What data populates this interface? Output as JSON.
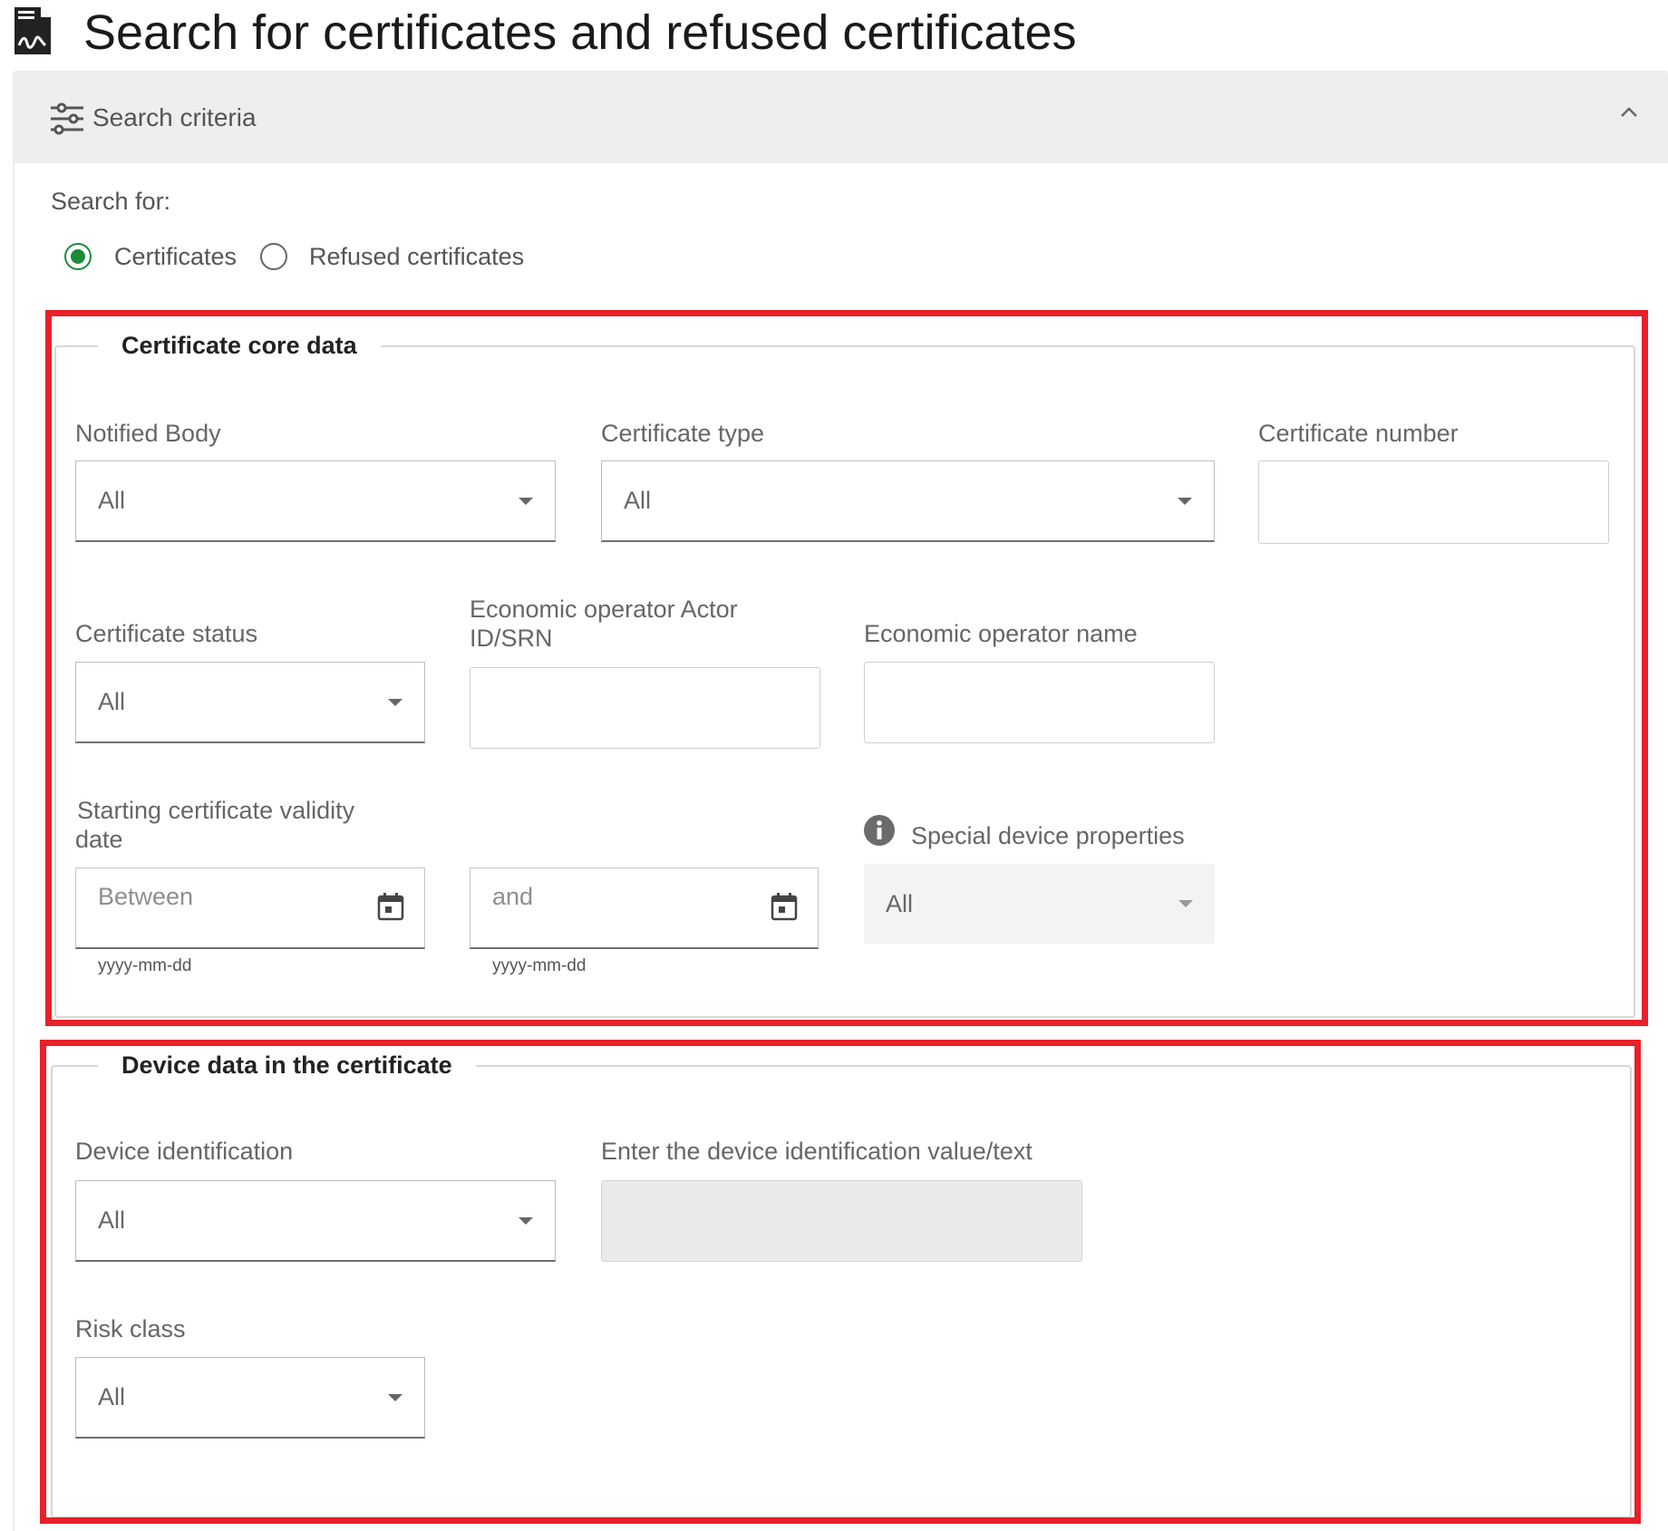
{
  "page": {
    "title": "Search for certificates and refused certificates"
  },
  "panel": {
    "header_label": "Search criteria"
  },
  "search_for": {
    "label": "Search for:",
    "options": [
      {
        "label": "Certificates",
        "selected": true
      },
      {
        "label": "Refused certificates",
        "selected": false
      }
    ]
  },
  "core": {
    "legend": "Certificate core data",
    "notified_body": {
      "label": "Notified Body",
      "value": "All"
    },
    "certificate_type": {
      "label": "Certificate type",
      "value": "All"
    },
    "certificate_number": {
      "label": "Certificate number",
      "value": ""
    },
    "certificate_status": {
      "label": "Certificate status",
      "value": "All"
    },
    "eo_actor_id": {
      "label_line1": "Economic operator Actor",
      "label_line2": "ID/SRN",
      "value": ""
    },
    "eo_name": {
      "label": "Economic operator name",
      "value": ""
    },
    "validity": {
      "label_line1": "Starting certificate validity",
      "label_line2": "date",
      "from_placeholder": "Between",
      "to_placeholder": "and",
      "format_hint": "yyyy-mm-dd"
    },
    "special_properties": {
      "label": "Special device properties",
      "value": "All"
    }
  },
  "device": {
    "legend": "Device data in the certificate",
    "device_identification": {
      "label": "Device identification",
      "value": "All"
    },
    "identification_value": {
      "label": "Enter the device identification value/text",
      "value": ""
    },
    "risk_class": {
      "label": "Risk class",
      "value": "All"
    }
  },
  "colors": {
    "accent": "#1c8a3a",
    "highlight": "#e8202a"
  }
}
